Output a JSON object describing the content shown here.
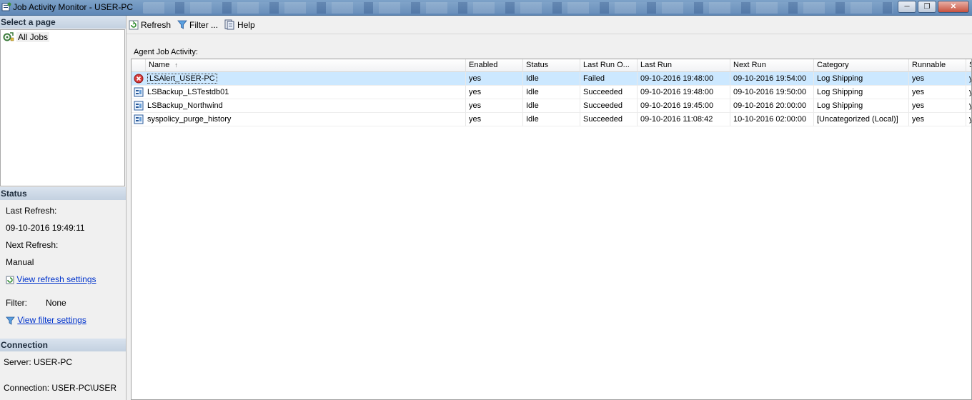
{
  "window": {
    "title": "Job Activity Monitor - USER-PC",
    "controls": [
      "minimize",
      "restore",
      "close"
    ]
  },
  "sidebar": {
    "select_page_header": "Select a page",
    "pages": [
      {
        "label": "All Jobs",
        "icon": "jobs-icon"
      }
    ],
    "status_header": "Status",
    "last_refresh_label": "Last Refresh:",
    "last_refresh_value": "09-10-2016 19:49:11",
    "next_refresh_label": "Next Refresh:",
    "next_refresh_value": "Manual",
    "view_refresh_link": "View refresh settings",
    "filter_label": "Filter:",
    "filter_value": "None",
    "view_filter_link": "View filter settings",
    "connection_header": "Connection",
    "server_text": "Server: USER-PC",
    "connection_text": "Connection: USER-PC\\USER"
  },
  "toolbar": {
    "refresh": "Refresh",
    "filter": "Filter ...",
    "help": "Help"
  },
  "grid": {
    "section_label": "Agent Job Activity:",
    "columns": [
      "Name",
      "Enabled",
      "Status",
      "Last Run O...",
      "Last Run",
      "Next Run",
      "Category",
      "Runnable",
      "S"
    ],
    "sort_indicator": "↑",
    "rows": [
      {
        "name": "LSAlert_USER-PC",
        "enabled": "yes",
        "status": "Idle",
        "outcome": "Failed",
        "last_run": "09-10-2016 19:48:00",
        "next_run": "09-10-2016 19:54:00",
        "category": "Log Shipping",
        "runnable": "yes",
        "extra": "y",
        "icon": "job-failed-icon",
        "selected": true
      },
      {
        "name": "LSBackup_LSTestdb01",
        "enabled": "yes",
        "status": "Idle",
        "outcome": "Succeeded",
        "last_run": "09-10-2016 19:48:00",
        "next_run": "09-10-2016 19:50:00",
        "category": "Log Shipping",
        "runnable": "yes",
        "extra": "y",
        "icon": "job-icon",
        "selected": false
      },
      {
        "name": "LSBackup_Northwind",
        "enabled": "yes",
        "status": "Idle",
        "outcome": "Succeeded",
        "last_run": "09-10-2016 19:45:00",
        "next_run": "09-10-2016 20:00:00",
        "category": "Log Shipping",
        "runnable": "yes",
        "extra": "y",
        "icon": "job-icon",
        "selected": false
      },
      {
        "name": "syspolicy_purge_history",
        "enabled": "yes",
        "status": "Idle",
        "outcome": "Succeeded",
        "last_run": "09-10-2016 11:08:42",
        "next_run": "10-10-2016 02:00:00",
        "category": "[Uncategorized (Local)]",
        "runnable": "yes",
        "extra": "y",
        "icon": "job-icon",
        "selected": false
      }
    ]
  },
  "colors": {
    "selection": "#cce8ff",
    "link": "#0033cc",
    "header_gradient_top": "#d9e3ee",
    "titlebar": "#6b92bf"
  }
}
